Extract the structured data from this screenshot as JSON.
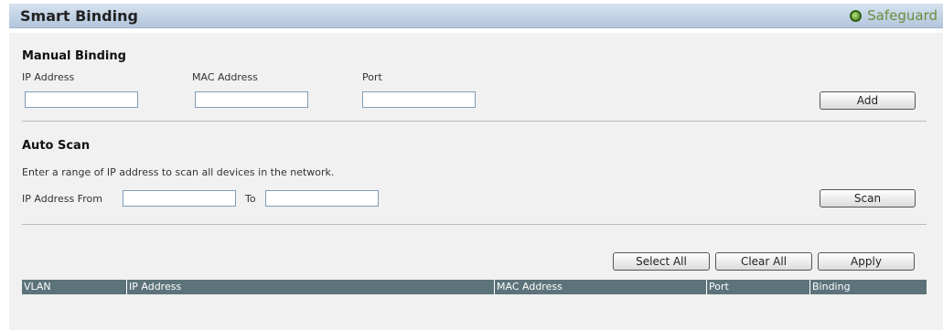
{
  "header": {
    "title": "Smart Binding",
    "safeguard_label": "Safeguard"
  },
  "manual_binding": {
    "title": "Manual Binding",
    "ip_label": "IP Address",
    "mac_label": "MAC Address",
    "port_label": "Port",
    "ip_value": "",
    "mac_value": "",
    "port_value": "",
    "add_button": "Add"
  },
  "auto_scan": {
    "title": "Auto Scan",
    "description": "Enter a range of IP address to scan all devices in the network.",
    "from_label": "IP Address From",
    "to_label": "To",
    "from_value": "",
    "to_value": "",
    "scan_button": "Scan"
  },
  "actions": {
    "select_all": "Select All",
    "clear_all": "Clear All",
    "apply": "Apply"
  },
  "table": {
    "columns": [
      "VLAN",
      "IP Address",
      "MAC Address",
      "Port",
      "Binding"
    ],
    "rows": []
  },
  "colors": {
    "title_bar": "#c4d4e6",
    "table_header": "#5c7379",
    "safeguard_text": "#6b8e3e"
  }
}
